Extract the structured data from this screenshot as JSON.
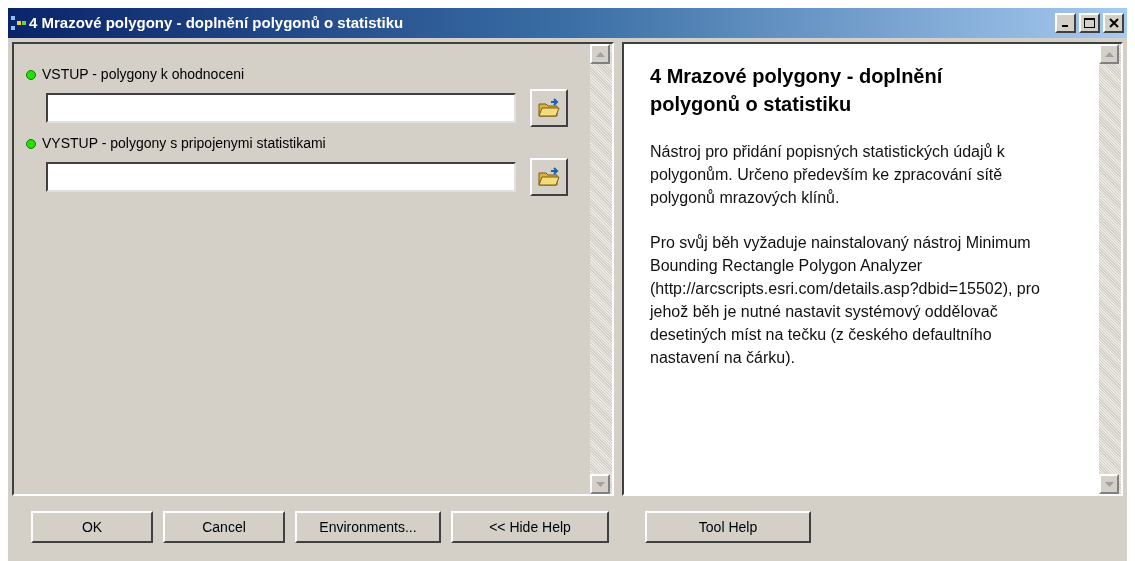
{
  "window": {
    "title": "4 Mrazové polygony - doplnění polygonů o statistiku"
  },
  "parameters": [
    {
      "label": "VSTUP - polygony k ohodnoceni"
    },
    {
      "label": "VYSTUP - polygony s pripojenymi statistikami"
    }
  ],
  "help": {
    "title": "4 Mrazové polygony - doplnění polygonů o statistiku",
    "paragraphs": [
      "Nástroj pro přidání popisných statistických údajů k polygonům. Určeno především ke zpracování sítě polygonů mrazových klínů.",
      "Pro svůj běh vyžaduje nainstalovaný nástroj Minimum Bounding Rectangle Polygon Analyzer (http://arcscripts.esri.com/details.asp?dbid=15502), pro jehož běh je nutné nastavit systémový oddělovač desetiných míst na tečku (z českého defaultního nastavení na čárku)."
    ]
  },
  "buttons": [
    "OK",
    "Cancel",
    "Environments...",
    "<< Hide Help"
  ],
  "help_button": "Tool Help"
}
